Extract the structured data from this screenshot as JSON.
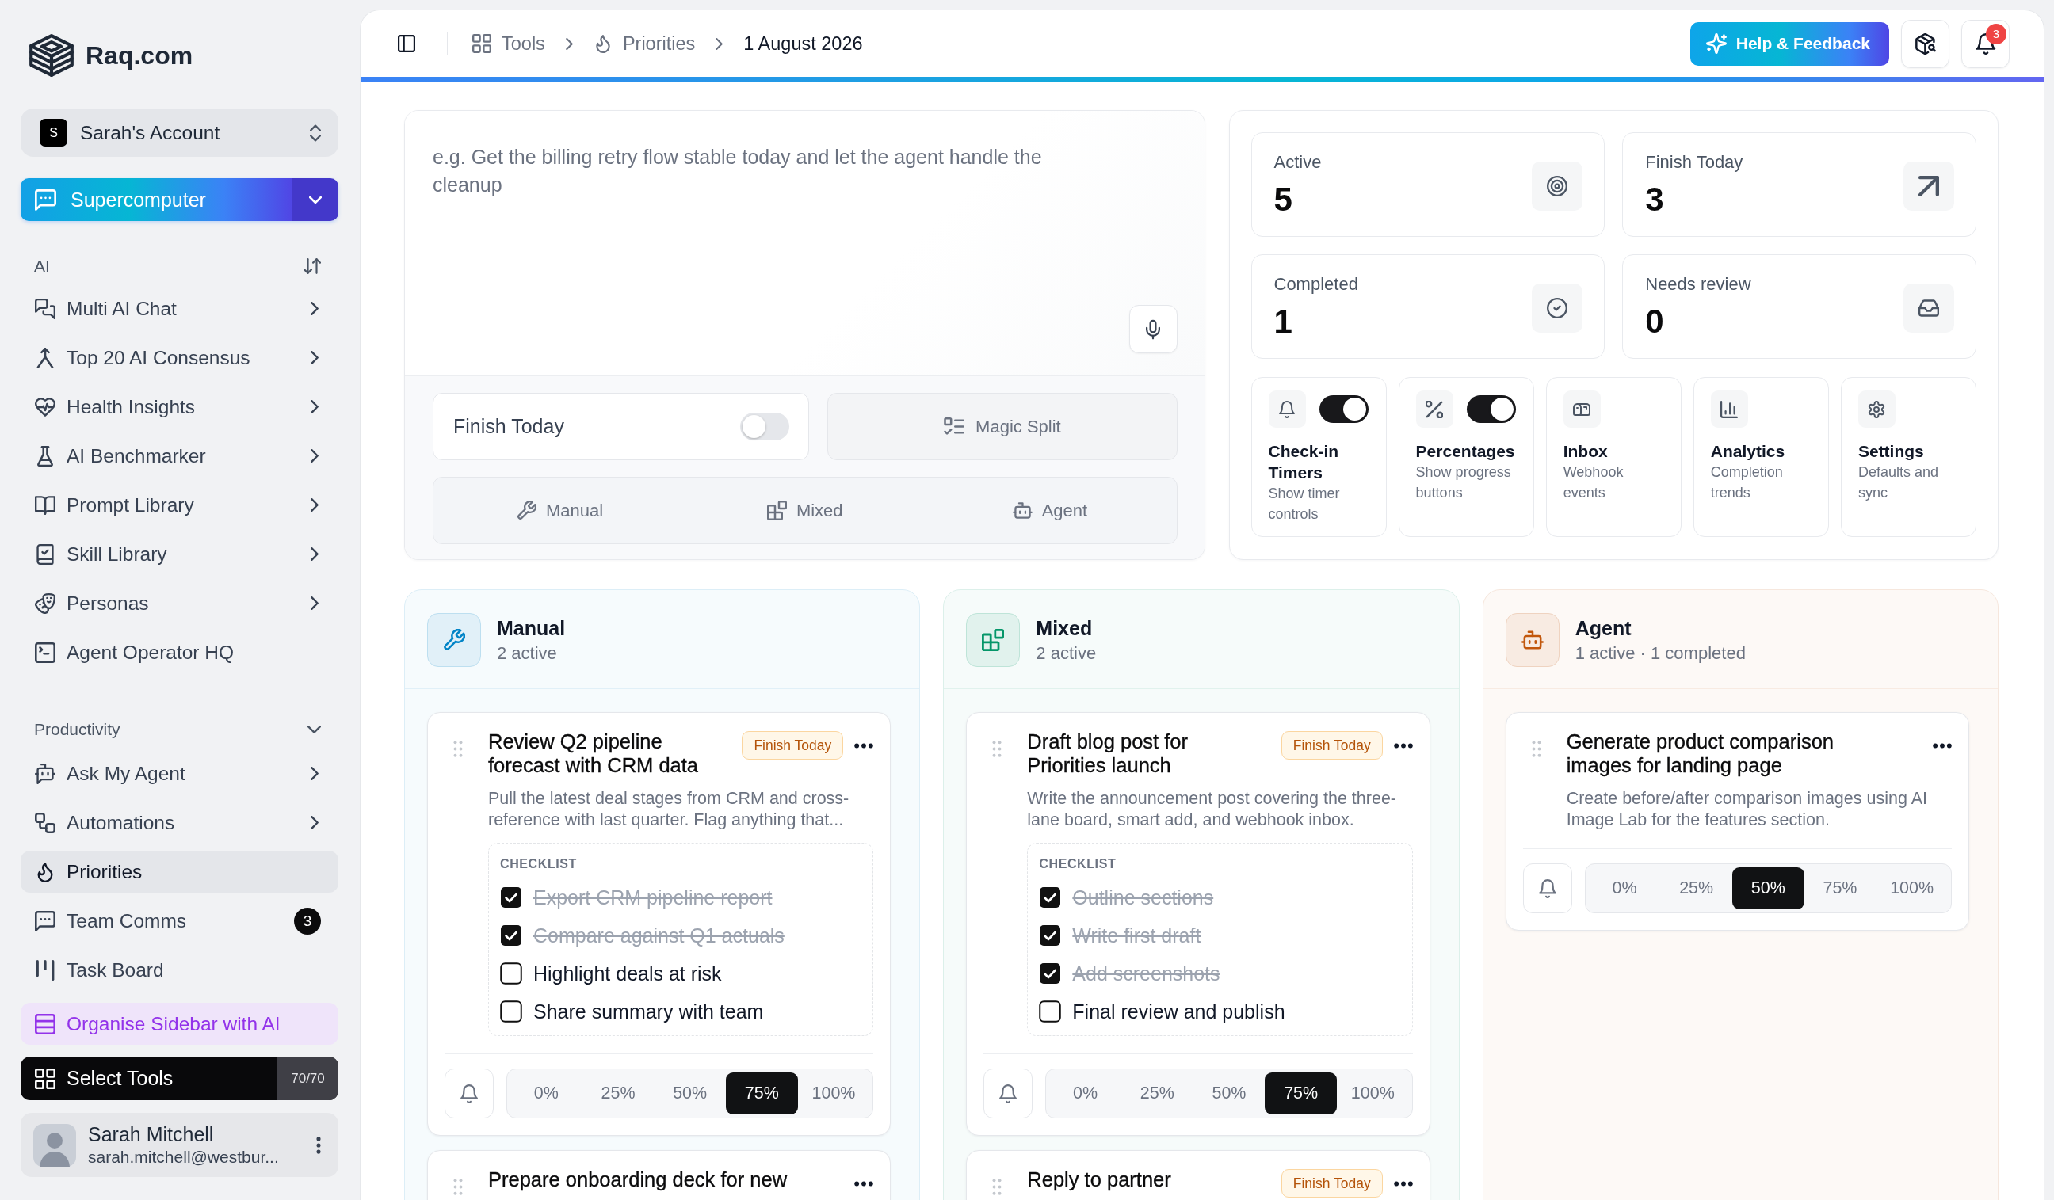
{
  "sidebar": {
    "brand": "Raq.com",
    "account": {
      "initial": "S",
      "name": "Sarah's Account"
    },
    "launcher": {
      "label": "Supercomputer"
    },
    "sections": [
      {
        "title": "AI",
        "kind": "sortable",
        "items": [
          {
            "label": "Multi AI Chat",
            "submenu": true,
            "selected": false
          },
          {
            "label": "Top 20 AI Consensus",
            "submenu": true,
            "selected": false
          },
          {
            "label": "Health Insights",
            "submenu": true,
            "selected": false
          },
          {
            "label": "AI Benchmarker",
            "submenu": true,
            "selected": false
          },
          {
            "label": "Prompt Library",
            "submenu": true,
            "selected": false
          },
          {
            "label": "Skill Library",
            "submenu": true,
            "selected": false
          },
          {
            "label": "Personas",
            "submenu": true,
            "selected": false
          },
          {
            "label": "Agent Operator HQ",
            "submenu": false,
            "selected": false
          }
        ]
      },
      {
        "title": "Productivity",
        "kind": "collapsible",
        "expanded": true,
        "items": [
          {
            "label": "Ask My Agent",
            "submenu": true,
            "selected": false
          },
          {
            "label": "Automations",
            "submenu": true,
            "selected": false
          },
          {
            "label": "Priorities",
            "submenu": false,
            "selected": true
          },
          {
            "label": "Team Comms",
            "submenu": false,
            "selected": false,
            "badge": "3"
          },
          {
            "label": "Task Board",
            "submenu": false,
            "selected": false
          }
        ]
      }
    ],
    "organise_button": "Organise Sidebar with AI",
    "tools_button": {
      "label": "Select Tools",
      "count": "70/70"
    },
    "user": {
      "name": "Sarah Mitchell",
      "email": "sarah.mitchell@westbur..."
    }
  },
  "topbar": {
    "breadcrumbs": [
      {
        "label": "Tools",
        "current": false
      },
      {
        "label": "Priorities",
        "current": false
      },
      {
        "label": "1 August 2026",
        "current": true
      }
    ],
    "help_button": "Help & Feedback",
    "notifications": {
      "count": "3"
    }
  },
  "composer": {
    "placeholder": "e.g. Get the billing retry flow stable today and let the agent handle the cleanup",
    "finish_today": {
      "label": "Finish Today",
      "on": false
    },
    "magic_split": {
      "label": "Magic Split",
      "disabled": true
    },
    "modes": [
      {
        "label": "Manual",
        "selected": false
      },
      {
        "label": "Mixed",
        "selected": false
      },
      {
        "label": "Agent",
        "selected": false
      }
    ]
  },
  "stats": [
    {
      "label": "Active",
      "value": "5"
    },
    {
      "label": "Finish Today",
      "value": "3"
    },
    {
      "label": "Completed",
      "value": "1"
    },
    {
      "label": "Needs review",
      "value": "0"
    }
  ],
  "features": [
    {
      "title": "Check-in Timers",
      "subtitle": "Show timer controls",
      "kind": "toggle",
      "on": true
    },
    {
      "title": "Percentages",
      "subtitle": "Show progress buttons",
      "kind": "toggle",
      "on": true
    },
    {
      "title": "Inbox",
      "subtitle": "Webhook events",
      "kind": "panel"
    },
    {
      "title": "Analytics",
      "subtitle": "Completion trends",
      "kind": "panel"
    },
    {
      "title": "Settings",
      "subtitle": "Defaults and sync",
      "kind": "panel"
    }
  ],
  "lanes": [
    {
      "title": "Manual",
      "subtitle": "2 active",
      "color": "#0284c7",
      "tasks": [
        {
          "title": "Review Q2 pipeline forecast with CRM data",
          "badge": "Finish Today",
          "description": "Pull the latest deal stages from CRM and cross-reference with last quarter. Flag anything that...",
          "checklist": {
            "title": "CHECKLIST",
            "items": [
              {
                "label": "Export CRM pipeline report",
                "checked": true
              },
              {
                "label": "Compare against Q1 actuals",
                "checked": true
              },
              {
                "label": "Highlight deals at risk",
                "checked": false
              },
              {
                "label": "Share summary with team",
                "checked": false
              }
            ]
          },
          "progress": [
            {
              "label": "0%",
              "selected": false
            },
            {
              "label": "25%",
              "selected": false
            },
            {
              "label": "50%",
              "selected": false
            },
            {
              "label": "75%",
              "selected": true
            },
            {
              "label": "100%",
              "selected": false
            }
          ]
        },
        {
          "title": "Prepare onboarding deck for new"
        }
      ]
    },
    {
      "title": "Mixed",
      "subtitle": "2 active",
      "color": "#059669",
      "tasks": [
        {
          "title": "Draft blog post for Priorities launch",
          "badge": "Finish Today",
          "description": "Write the announcement post covering the three-lane board, smart add, and webhook inbox.",
          "checklist": {
            "title": "CHECKLIST",
            "items": [
              {
                "label": "Outline sections",
                "checked": true
              },
              {
                "label": "Write first draft",
                "checked": true
              },
              {
                "label": "Add screenshots",
                "checked": true
              },
              {
                "label": "Final review and publish",
                "checked": false
              }
            ]
          },
          "progress": [
            {
              "label": "0%",
              "selected": false
            },
            {
              "label": "25%",
              "selected": false
            },
            {
              "label": "50%",
              "selected": false
            },
            {
              "label": "75%",
              "selected": true
            },
            {
              "label": "100%",
              "selected": false
            }
          ]
        },
        {
          "title": "Reply to partner",
          "badge": "Finish Today"
        }
      ]
    },
    {
      "title": "Agent",
      "subtitle": "1 active · 1 completed",
      "color": "#c2570c",
      "tasks": [
        {
          "title": "Generate product comparison images for landing page",
          "description": "Create before/after comparison images using AI Image Lab for the features section.",
          "progress": [
            {
              "label": "0%",
              "selected": false
            },
            {
              "label": "25%",
              "selected": false
            },
            {
              "label": "50%",
              "selected": true
            },
            {
              "label": "75%",
              "selected": false
            },
            {
              "label": "100%",
              "selected": false
            }
          ]
        }
      ]
    }
  ]
}
